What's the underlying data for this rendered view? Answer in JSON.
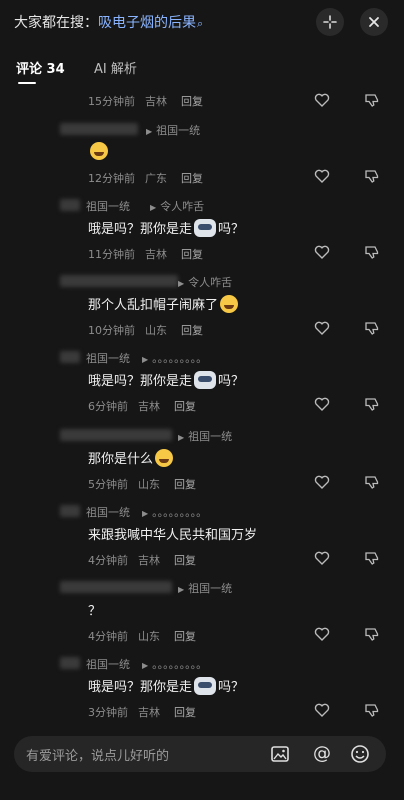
{
  "header": {
    "search_prefix": "大家都在搜：",
    "search_keyword": "吸电子烟的后果",
    "icons": [
      "expand-icon",
      "close-icon"
    ]
  },
  "tabs": [
    {
      "label": "评论 34"
    },
    {
      "label": "AI 解析"
    }
  ],
  "comments": [
    {
      "name": "",
      "reply_to": "",
      "text": "",
      "emoji": "",
      "time": "15分钟前",
      "location": "吉林",
      "reply": "回复"
    },
    {
      "name": "",
      "reply_to": "祖国一统",
      "text": "",
      "emoji": "sleep",
      "time": "12分钟前",
      "location": "广东",
      "reply": "回复"
    },
    {
      "name": "祖国一统",
      "reply_to": "令人咋舌",
      "text_before": "哦是吗？那你是走",
      "text_after": "吗？",
      "emoji": "wolf",
      "time": "11分钟前",
      "location": "吉林",
      "reply": "回复"
    },
    {
      "name": "",
      "reply_to": "令人咋舌",
      "text_before": "那个人乱扣帽子闹麻了",
      "text_after": "",
      "emoji": "laugh",
      "time": "10分钟前",
      "location": "山东",
      "reply": "回复"
    },
    {
      "name": "祖国一统",
      "reply_to": "。。。。。。。。。",
      "text_before": "哦是吗？那你是走",
      "text_after": "吗？",
      "emoji": "wolf",
      "time": "6分钟前",
      "location": "吉林",
      "reply": "回复"
    },
    {
      "name": "",
      "reply_to": "祖国一统",
      "text_before": "那你是什么",
      "text_after": "",
      "emoji": "laugh",
      "time": "5分钟前",
      "location": "山东",
      "reply": "回复"
    },
    {
      "name": "祖国一统",
      "reply_to": "。。。。。。。。。",
      "text_before": "来跟我喊中华人民共和国万岁",
      "text_after": "",
      "emoji": "",
      "time": "4分钟前",
      "location": "吉林",
      "reply": "回复"
    },
    {
      "name": "",
      "reply_to": "祖国一统",
      "text_before": "？",
      "text_after": "",
      "emoji": "",
      "time": "4分钟前",
      "location": "山东",
      "reply": "回复"
    },
    {
      "name": "祖国一统",
      "reply_to": "。。。。。。。。。",
      "text_before": "哦是吗？那你是走",
      "text_after": "吗？",
      "emoji": "wolf",
      "time": "3分钟前",
      "location": "吉林",
      "reply": "回复"
    }
  ],
  "input": {
    "placeholder": "有爱评论，说点儿好听的"
  }
}
